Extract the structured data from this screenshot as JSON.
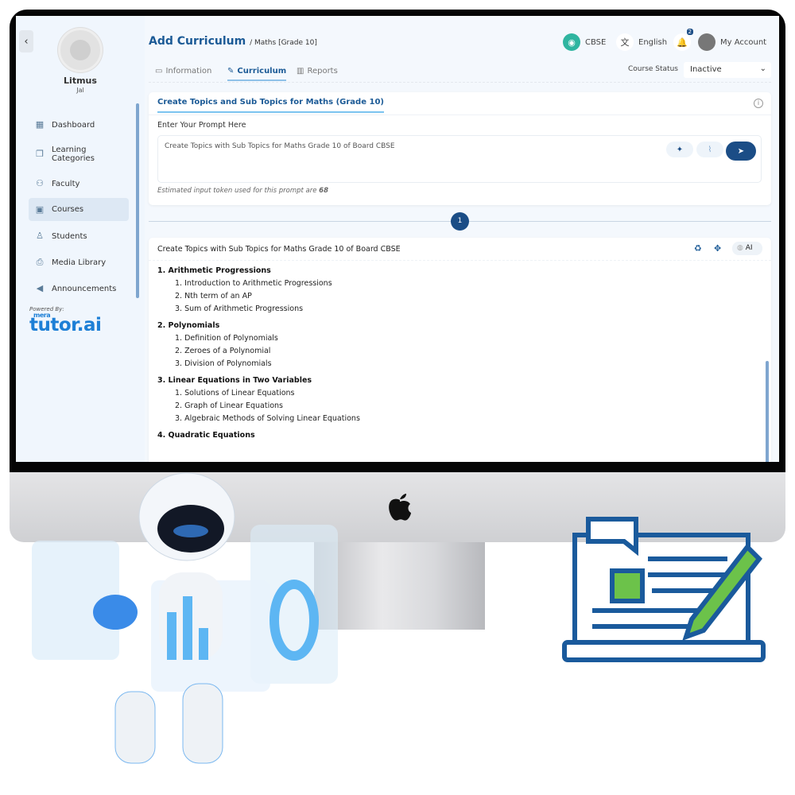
{
  "sidebar": {
    "org_name": "Litmus",
    "org_sub": "Jal",
    "items": [
      {
        "label": "Dashboard",
        "icon": "dashboard-icon"
      },
      {
        "label": "Learning Categories",
        "icon": "categories-icon"
      },
      {
        "label": "Faculty",
        "icon": "faculty-icon"
      },
      {
        "label": "Courses",
        "icon": "courses-icon",
        "active": true
      },
      {
        "label": "Students",
        "icon": "student-icon"
      },
      {
        "label": "Media Library",
        "icon": "media-icon"
      },
      {
        "label": "Announcements",
        "icon": "megaphone-icon"
      }
    ],
    "powered_by": "Powered By:",
    "brand": "tutor.ai",
    "brand_prefix": "mera"
  },
  "header": {
    "title": "Add Curriculum",
    "breadcrumb": "/ Maths [Grade 10]",
    "board": "CBSE",
    "language": "English",
    "notifications": "2",
    "account": "My Account"
  },
  "tabs": [
    {
      "label": "Information"
    },
    {
      "label": "Curriculum",
      "active": true
    },
    {
      "label": "Reports"
    }
  ],
  "course_status": {
    "label": "Course Status",
    "value": "Inactive"
  },
  "prompt_card": {
    "title": "Create Topics and Sub Topics for Maths (Grade 10)",
    "label": "Enter Your Prompt Here",
    "value": "Create Topics with Sub Topics for Maths Grade 10 of Board CBSE",
    "token_note": "Estimated input token used for this prompt are",
    "token_count": "68"
  },
  "step": "1",
  "result_card": {
    "title": "Create Topics with Sub Topics for Maths Grade 10 of Board CBSE",
    "ai_label": "AI",
    "topics": [
      {
        "title": "1. Arithmetic Progressions",
        "subs": [
          "1. Introduction to Arithmetic Progressions",
          "2. Nth term of an AP",
          "3. Sum of Arithmetic Progressions"
        ]
      },
      {
        "title": "2. Polynomials",
        "subs": [
          "1. Definition of Polynomials",
          "2. Zeroes of a Polynomial",
          "3. Division of Polynomials"
        ]
      },
      {
        "title": "3. Linear Equations in Two Variables",
        "subs": [
          "1. Solutions of Linear Equations",
          "2. Graph of Linear Equations",
          "3. Algebraic Methods of Solving Linear Equations"
        ]
      },
      {
        "title": "4. Quadratic Equations",
        "subs": []
      }
    ]
  },
  "colors": {
    "primary": "#1b4d86",
    "accent": "#1b5a96",
    "sidebar_bg": "#f0f6fd"
  }
}
